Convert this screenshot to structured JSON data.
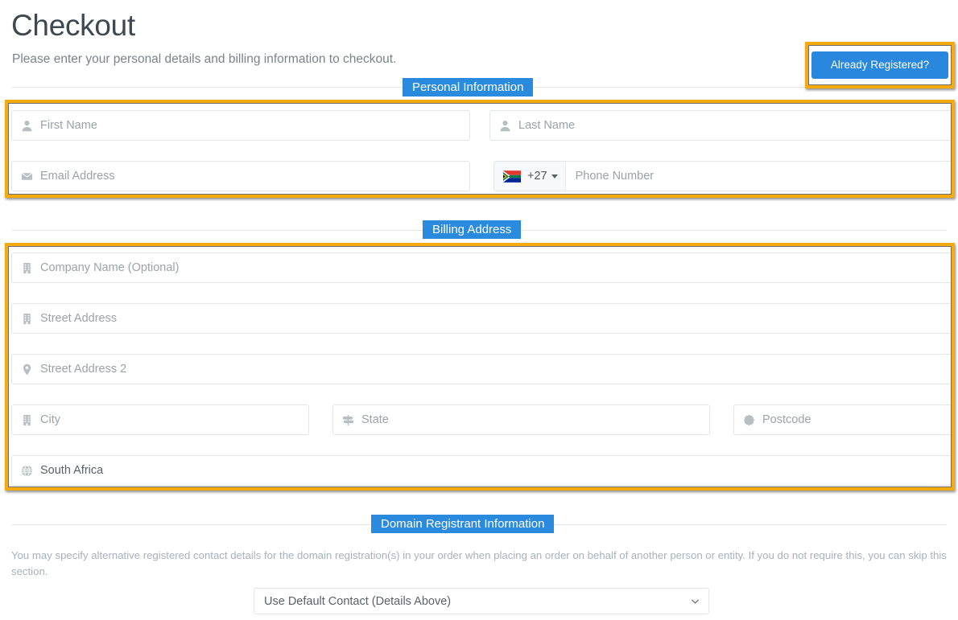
{
  "header": {
    "title": "Checkout",
    "subtitle": "Please enter your personal details and billing information to checkout.",
    "already_registered_label": "Already Registered?"
  },
  "colors": {
    "accent_blue": "#2a8ade",
    "highlight_orange": "#f5ab10",
    "title_gray": "#3d4852",
    "placeholder_gray": "#9ba2a9"
  },
  "sections": {
    "personal": {
      "label": "Personal Information"
    },
    "billing": {
      "label": "Billing Address"
    },
    "registrant": {
      "label": "Domain Registrant Information",
      "note": "You may specify alternative registered contact details for the domain registration(s) in your order when placing an order on behalf of another person or entity. If you do not require this, you can skip this section.",
      "select_value": "Use Default Contact (Details Above)"
    }
  },
  "personal_fields": {
    "first_name": {
      "placeholder": "First Name",
      "value": "",
      "icon": "user-icon"
    },
    "last_name": {
      "placeholder": "Last Name",
      "value": "",
      "icon": "user-icon"
    },
    "email": {
      "placeholder": "Email Address",
      "value": "",
      "icon": "envelope-icon"
    },
    "phone": {
      "placeholder": "Phone Number",
      "value": "",
      "dial_code": "+27",
      "flag": "south-africa-flag"
    }
  },
  "billing_fields": {
    "company": {
      "placeholder": "Company Name (Optional)",
      "value": "",
      "icon": "building-icon"
    },
    "street1": {
      "placeholder": "Street Address",
      "value": "",
      "icon": "building-icon"
    },
    "street2": {
      "placeholder": "Street Address 2",
      "value": "",
      "icon": "map-pin-icon"
    },
    "city": {
      "placeholder": "City",
      "value": "",
      "icon": "building-icon"
    },
    "state": {
      "placeholder": "State",
      "value": "",
      "icon": "signpost-icon"
    },
    "postcode": {
      "placeholder": "Postcode",
      "value": "",
      "icon": "seal-icon"
    },
    "country": {
      "placeholder": "",
      "value": "South Africa",
      "icon": "globe-icon"
    }
  }
}
